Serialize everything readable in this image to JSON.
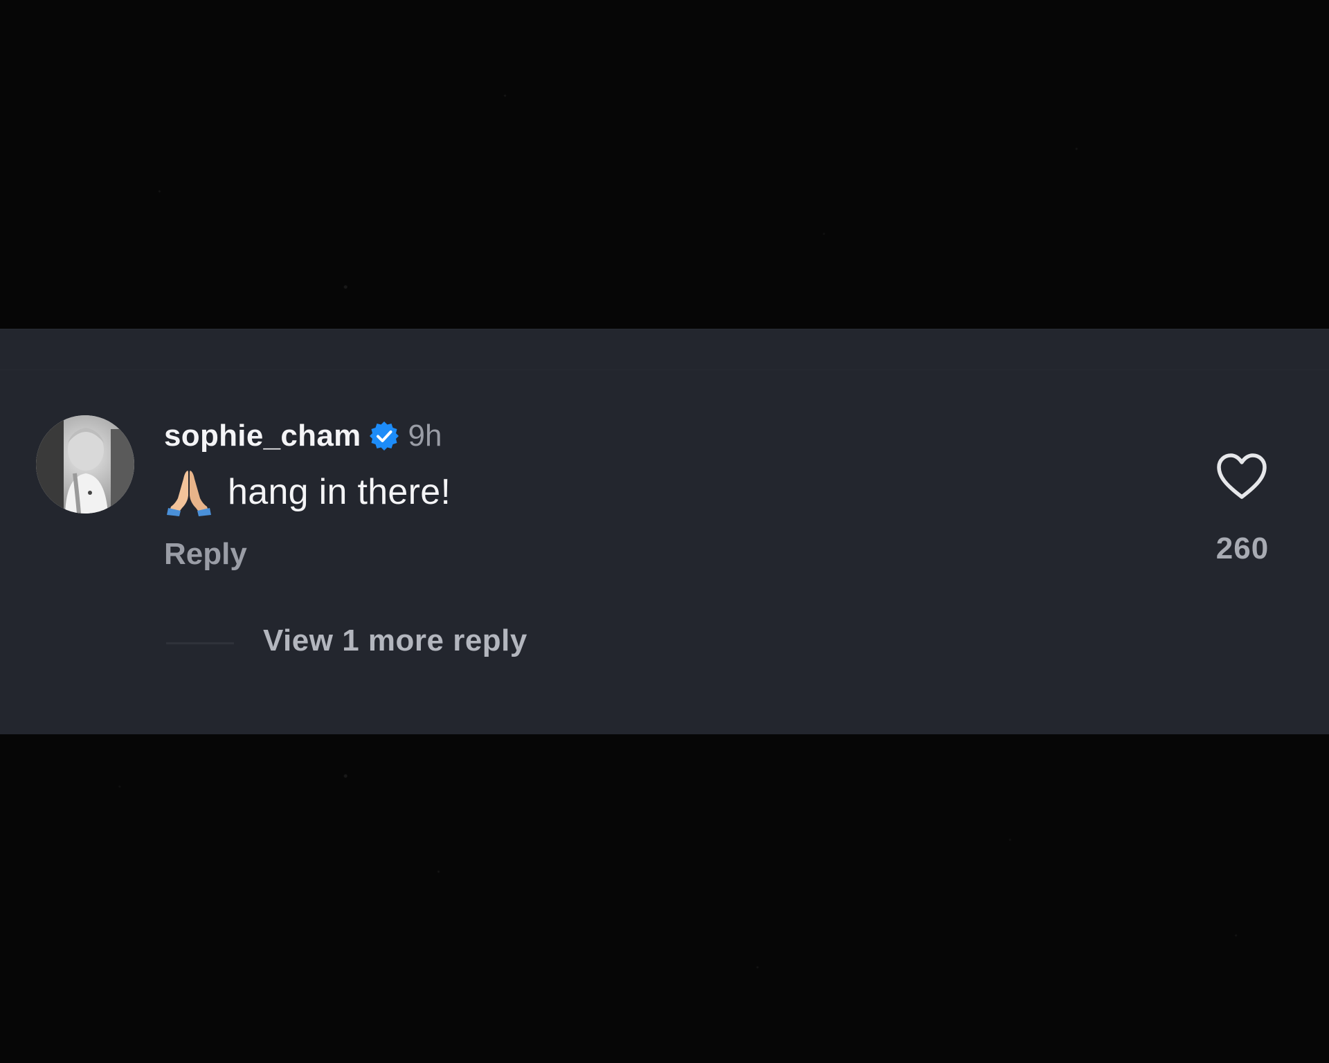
{
  "comment": {
    "username": "sophie_cham",
    "verified": true,
    "timestamp": "9h",
    "emoji_icon": "folded-hands-icon",
    "text": "hang in there!",
    "reply_label": "Reply",
    "like_icon": "heart-outline-icon",
    "like_count": "260",
    "view_replies_label": "View 1 more reply"
  },
  "colors": {
    "panel_background": "#23262e",
    "page_background": "#060606",
    "verified_badge": "#1d8cf8",
    "primary_text": "#f4f4f6",
    "secondary_text": "#9a9da6"
  }
}
